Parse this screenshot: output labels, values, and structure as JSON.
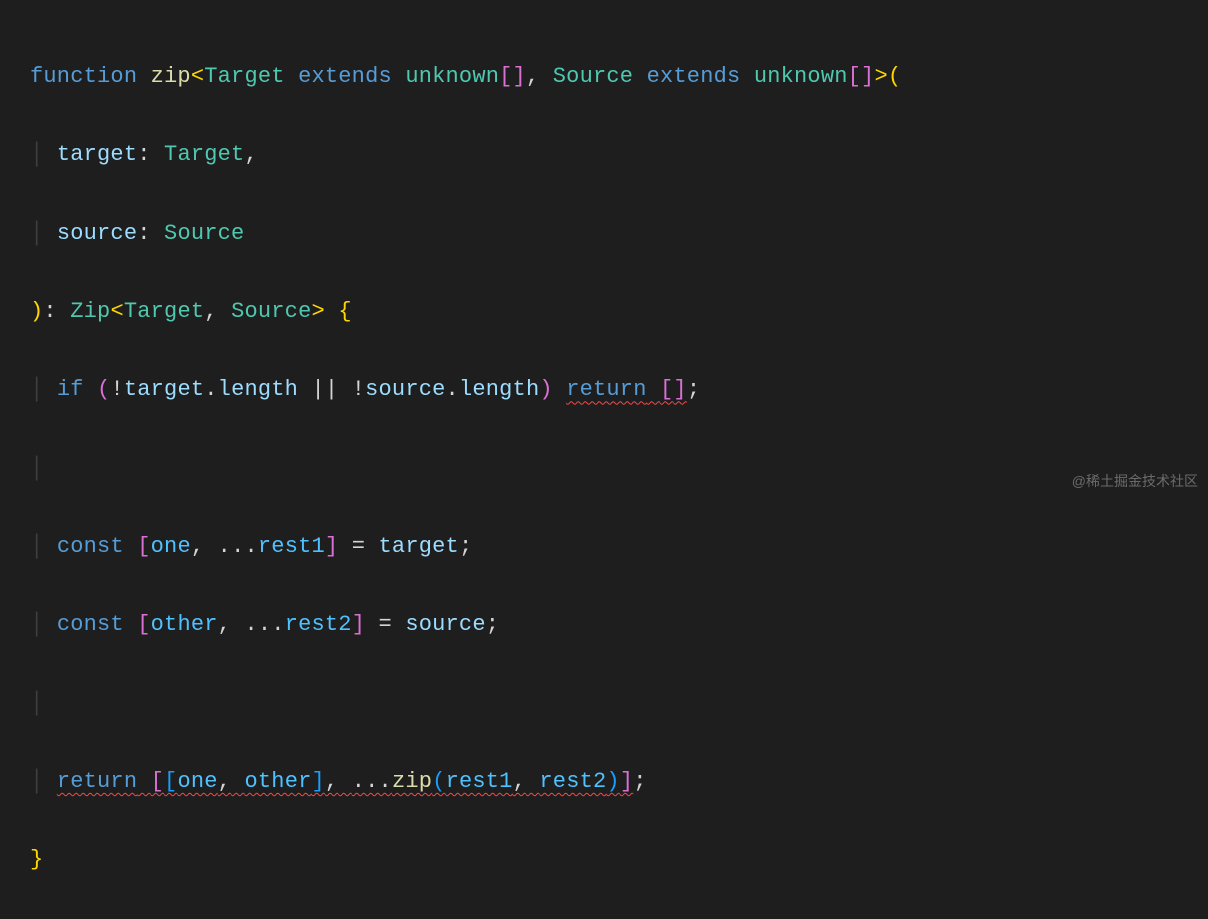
{
  "code": {
    "line1": {
      "kw_function": "function",
      "fn_name": "zip",
      "lt": "<",
      "t_target": "Target",
      "kw_extends1": "extends",
      "t_unknown1": "unknown",
      "brackets1": "[]",
      "comma1": ",",
      "t_source": "Source",
      "kw_extends2": "extends",
      "t_unknown2": "unknown",
      "brackets2": "[]",
      "gt": ">",
      "paren_open": "("
    },
    "line2": {
      "guide": "│",
      "p_target": "target",
      "colon": ":",
      "t_target": "Target",
      "comma": ","
    },
    "line3": {
      "guide": "│",
      "p_source": "source",
      "colon": ":",
      "t_source": "Source"
    },
    "line4": {
      "paren_close": ")",
      "colon": ":",
      "t_zip": "Zip",
      "lt": "<",
      "t_target": "Target",
      "comma": ",",
      "t_source": "Source",
      "gt": ">",
      "brace_open": "{"
    },
    "line5": {
      "guide": "│",
      "kw_if": "if",
      "paren_open": "(",
      "bang1": "!",
      "v_target": "target",
      "dot1": ".",
      "p_length1": "length",
      "or": "||",
      "bang2": "!",
      "v_source": "source",
      "dot2": ".",
      "p_length2": "length",
      "paren_close": ")",
      "kw_return": "return",
      "sq_open": "[",
      "sq_close": "]",
      "semi": ";"
    },
    "line6": {
      "guide": "│"
    },
    "line7": {
      "guide": "│",
      "kw_const": "const",
      "sq_open": "[",
      "v_one": "one",
      "comma": ",",
      "spread": "...",
      "v_rest1": "rest1",
      "sq_close": "]",
      "eq": "=",
      "v_target": "target",
      "semi": ";"
    },
    "line8": {
      "guide": "│",
      "kw_const": "const",
      "sq_open": "[",
      "v_other": "other",
      "comma": ",",
      "spread": "...",
      "v_rest2": "rest2",
      "sq_close": "]",
      "eq": "=",
      "v_source": "source",
      "semi": ";"
    },
    "line9": {
      "guide": "│"
    },
    "line10": {
      "guide": "│",
      "kw_return": "return",
      "sq_open_outer": "[",
      "sq_open_inner": "[",
      "v_one": "one",
      "comma1": ",",
      "v_other": "other",
      "sq_close_inner": "]",
      "comma2": ",",
      "spread": "...",
      "fn_zip": "zip",
      "paren_open": "(",
      "v_rest1": "rest1",
      "comma3": ",",
      "v_rest2": "rest2",
      "paren_close": ")",
      "sq_close_outer": "]",
      "semi": ";"
    },
    "line11": {
      "brace_close": "}"
    }
  },
  "watermark": "@稀土掘金技术社区"
}
